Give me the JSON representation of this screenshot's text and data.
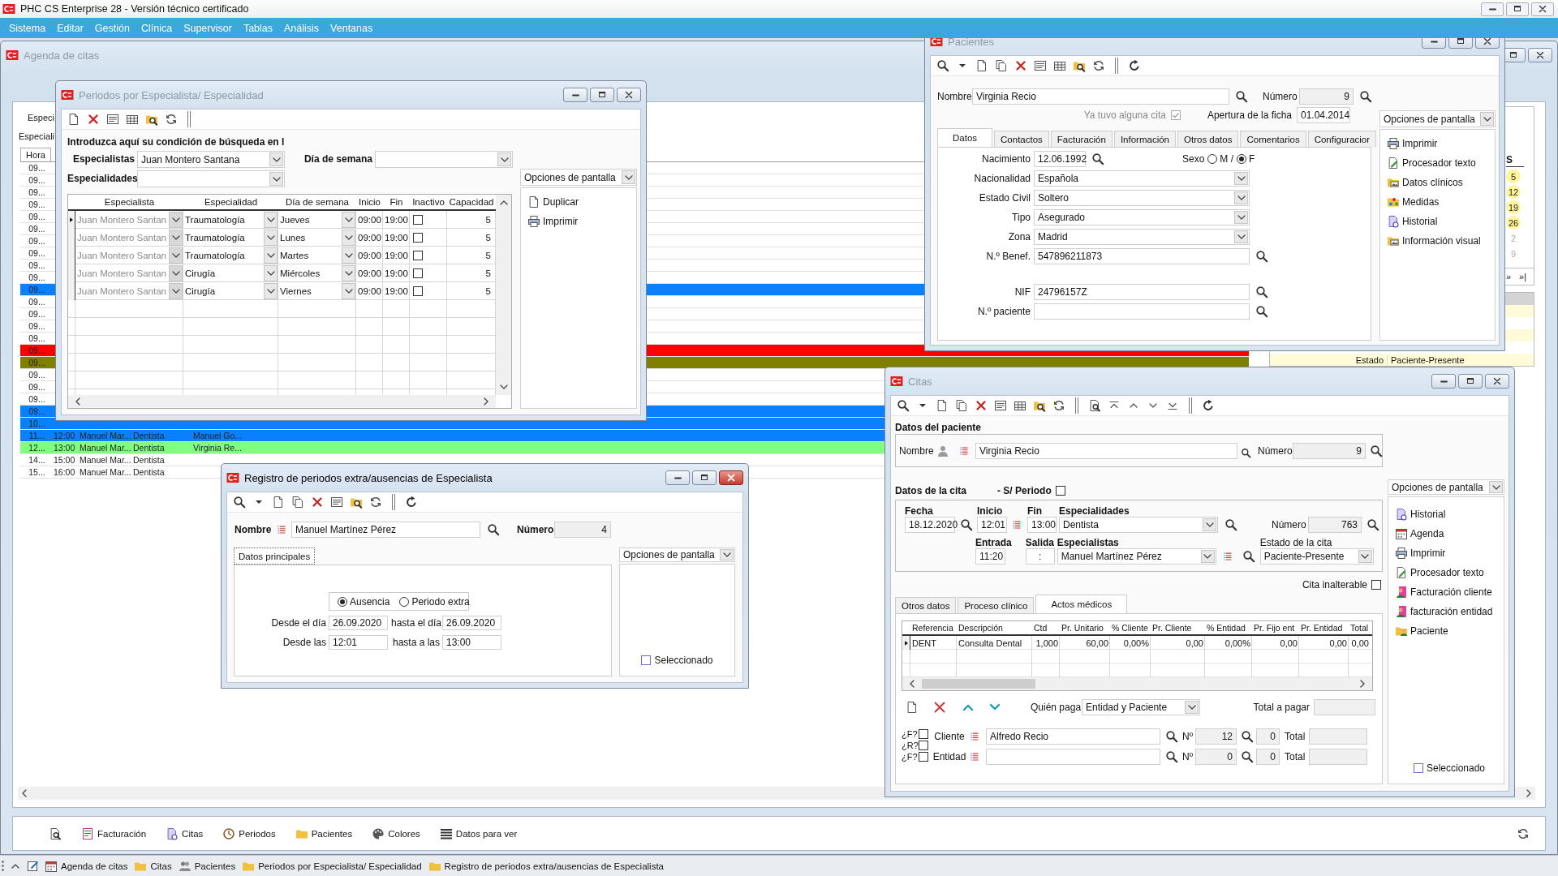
{
  "app": {
    "title": "PHC CS Enterprise 28 - Versión técnico certificado",
    "menu": [
      "Sistema",
      "Editar",
      "Gestión",
      "Clínica",
      "Supervisor",
      "Tablas",
      "Análisis",
      "Ventanas"
    ]
  },
  "agenda": {
    "title": "Agenda de citas",
    "active": false,
    "labels": [
      "Especi",
      "Especiali"
    ],
    "hora_header": "Hora",
    "rows": [
      {
        "cells": [
          "09..."
        ],
        "color": "#ffffff"
      },
      {
        "cells": [
          "09..."
        ],
        "color": "#ffffff"
      },
      {
        "cells": [
          "09..."
        ],
        "color": "#ffffff"
      },
      {
        "cells": [
          "09..."
        ],
        "color": "#ffffff"
      },
      {
        "cells": [
          "09..."
        ],
        "color": "#ffffff"
      },
      {
        "cells": [
          "09..."
        ],
        "color": "#ffffff"
      },
      {
        "cells": [
          "09..."
        ],
        "color": "#ffffff"
      },
      {
        "cells": [
          "09..."
        ],
        "color": "#ffffff"
      },
      {
        "cells": [
          "09..."
        ],
        "color": "#ffffff"
      },
      {
        "cells": [
          "09..."
        ],
        "color": "#ffffff"
      },
      {
        "cells": [
          "09..."
        ],
        "color": "#0a80ff"
      },
      {
        "cells": [
          "09..."
        ],
        "color": "#ffffff"
      },
      {
        "cells": [
          "09..."
        ],
        "color": "#ffffff"
      },
      {
        "cells": [
          "09..."
        ],
        "color": "#ffffff"
      },
      {
        "cells": [
          "09..."
        ],
        "color": "#ffffff"
      },
      {
        "cells": [
          "09..."
        ],
        "color": "#ff0000"
      },
      {
        "cells": [
          "09..."
        ],
        "color": "#808000"
      },
      {
        "cells": [
          "09..."
        ],
        "color": "#ffffff"
      },
      {
        "cells": [
          "09..."
        ],
        "color": "#ffffff"
      },
      {
        "cells": [
          "09..."
        ],
        "color": "#ffffff"
      },
      {
        "cells": [
          "09..."
        ],
        "color": "#0a80ff"
      },
      {
        "cells": [
          "10..."
        ],
        "color": "#0a80ff"
      },
      {
        "cells": [
          "11...",
          "12:00",
          "Manuel Mar...",
          "Dentista",
          "Manuel Go..."
        ],
        "color": "#0a80ff"
      },
      {
        "cells": [
          "12...",
          "13:00",
          "Manuel Mar...",
          "Dentista",
          "Virginia Re..."
        ],
        "color": "#80ff80"
      },
      {
        "cells": [
          "14...",
          "15:00",
          "Manuel Mar...",
          "Dentista"
        ],
        "color": "#ffffff"
      },
      {
        "cells": [
          "15...",
          "16:00",
          "Manuel Mar...",
          "Dentista"
        ],
        "color": "#ffffff"
      }
    ],
    "calendar": {
      "header": "S",
      "days": [
        {
          "label": "5",
          "marked": true
        },
        {
          "label": "12",
          "marked": true
        },
        {
          "label": "19",
          "marked": true
        },
        {
          "label": "26",
          "marked": true
        },
        {
          "label": "2",
          "marked": false
        },
        {
          "label": "9",
          "marked": false
        }
      ],
      "nav": [
        "»",
        "»|"
      ]
    },
    "details": [
      {
        "label": "Estado",
        "value": "Paciente-Presente"
      }
    ]
  },
  "periodos": {
    "title": "Periodos por Especialista/ Especialidad",
    "active": false,
    "prompt": "Introduzca aquí su condición de búsqueda en l",
    "filters": [
      {
        "label": "Especialistas",
        "value": "Juan Montero Santana"
      },
      {
        "label": "Día de semana"
      },
      {
        "label": "Especialidades"
      }
    ],
    "columns": [
      "Especialista",
      "Especialidad",
      "Día de semana",
      "Inicio",
      "Fin",
      "Inactivo",
      "Capacidad"
    ],
    "rows": [
      {
        "especialista": "Juan Montero Santan",
        "especialista_disabled": true,
        "especialidad": "Traumatología",
        "dia": "Jueves",
        "inicio": "09:00",
        "fin": "19:00",
        "inactivo": false,
        "capacidad": "5",
        "current": true
      },
      {
        "especialista": "Juan Montero Santan",
        "especialista_disabled": true,
        "especialidad": "Traumatología",
        "dia": "Lunes",
        "inicio": "09:00",
        "fin": "19:00",
        "inactivo": false,
        "capacidad": "5",
        "current": false
      },
      {
        "especialista": "Juan Montero Santan",
        "especialista_disabled": true,
        "especialidad": "Traumatología",
        "dia": "Martes",
        "inicio": "09:00",
        "fin": "19:00",
        "inactivo": false,
        "capacidad": "5",
        "current": false
      },
      {
        "especialista": "Juan Montero Santan",
        "especialista_disabled": true,
        "especialidad": "Cirugía",
        "dia": "Miércoles",
        "inicio": "09:00",
        "fin": "19:00",
        "inactivo": false,
        "capacidad": "5",
        "current": false
      },
      {
        "especialista": "Juan Montero Santan",
        "especialista_disabled": true,
        "especialidad": "Cirugía",
        "dia": "Viernes",
        "inicio": "09:00",
        "fin": "19:00",
        "inactivo": false,
        "capacidad": "5",
        "current": false
      }
    ],
    "options_label": "Opciones de pantalla",
    "actions": [
      "Duplicar",
      "Imprimir"
    ]
  },
  "pacientes": {
    "title": "Pacientes",
    "active": false,
    "nombre_label": "Nombre",
    "nombre": "Virginia Recio",
    "numero_label": "Número",
    "numero": "9",
    "ya_tuvo": {
      "label": "Ya tuvo alguna cita",
      "checked": true,
      "disabled": true
    },
    "apertura_label": "Apertura de la ficha",
    "apertura": "01.04.2014",
    "tabs": [
      {
        "label": "Datos",
        "selected": true
      },
      {
        "label": "Contactos",
        "selected": false
      },
      {
        "label": "Facturación",
        "selected": false
      },
      {
        "label": "Información",
        "selected": false
      },
      {
        "label": "Otros datos",
        "selected": false
      },
      {
        "label": "Comentarios",
        "selected": false
      },
      {
        "label": "Configuracior",
        "selected": false
      }
    ],
    "sexo": {
      "label": "Sexo",
      "options": [
        {
          "label": "M /",
          "selected": false
        },
        {
          "label": "F",
          "selected": true
        }
      ]
    },
    "fields": [
      {
        "kind": "date",
        "label": "Nacimiento",
        "value": "12.06.1992"
      },
      {
        "kind": "select",
        "label": "Nacionalidad",
        "value": "Española"
      },
      {
        "kind": "select",
        "label": "Estado Civil",
        "value": "Soltero"
      },
      {
        "kind": "select",
        "label": "Tipo",
        "value": "Asegurado"
      },
      {
        "kind": "select",
        "label": "Zona",
        "value": "Madrid"
      },
      {
        "kind": "search",
        "label": "N.º Benef.",
        "value": "547896211873"
      },
      {
        "kind": "search",
        "label": "NIF",
        "value": "24796157Z"
      },
      {
        "kind": "search",
        "label": "N.º paciente"
      }
    ],
    "options_label": "Opciones de pantalla",
    "actions": [
      "Imprimir",
      "Procesador texto",
      "Datos clínicos",
      "Medidas",
      "Historial",
      "Información visual"
    ]
  },
  "citas": {
    "title": "Citas",
    "active": false,
    "paciente": {
      "heading": "Datos del paciente",
      "nombre_label": "Nombre",
      "nombre": "Virginia Recio",
      "numero_label": "Número",
      "numero": "9"
    },
    "cita": {
      "heading": "Datos de la cita",
      "sin_periodo": {
        "label": "- S/ Periodo",
        "checked": false
      },
      "fecha": {
        "label": "Fecha",
        "value": "18.12.2020"
      },
      "inicio": {
        "label": "Inicio",
        "value": "12:01"
      },
      "fin": {
        "label": "Fin",
        "value": "13:00"
      },
      "especialidades": {
        "label": "Especialidades",
        "value": "Dentista"
      },
      "numero": {
        "label": "Número",
        "value": "763"
      },
      "entrada": {
        "label": "Entrada",
        "value": "11:20"
      },
      "salida": {
        "label": "Salida",
        "value": ":"
      },
      "especialistas": {
        "label": "Especialistas",
        "value": "Manuel Martínez Pérez"
      },
      "estado": {
        "label": "Estado de la cita",
        "value": "Paciente-Presente"
      },
      "inalterable": {
        "label": "Cita inalterable",
        "checked": false
      }
    },
    "tabs": [
      {
        "label": "Otros datos",
        "selected": false
      },
      {
        "label": "Proceso clínico",
        "selected": false
      },
      {
        "label": "Actos médicos",
        "selected": true
      }
    ],
    "table": {
      "columns": [
        "Referencia",
        "Descripción",
        "Ctd",
        "Pr. Unitario",
        "% Cliente",
        "Pr. Cliente",
        "% Entidad",
        "Pr. Fijo ent",
        "Pr. Entidad",
        "Total"
      ],
      "rows": [
        {
          "current": true,
          "cells": [
            "DENT",
            "Consulta Dental",
            "1,000",
            "60,00",
            "0,00%",
            "0,00",
            "0,00%",
            "0,00",
            "0,00",
            "0,00"
          ]
        }
      ]
    },
    "quien_paga": {
      "label": "Quién paga",
      "value": "Entidad y Paciente"
    },
    "total_pagar_label": "Total a pagar",
    "flags": [
      {
        "label": "¿F?",
        "checked": false
      },
      {
        "label": "¿R?",
        "checked": false
      },
      {
        "label": "¿F?",
        "checked": false
      }
    ],
    "payers": [
      {
        "label": "Cliente",
        "value": "Alfredo Recio",
        "n_label": "Nº",
        "n": "12",
        "count": "0",
        "total_label": "Total"
      },
      {
        "label": "Entidad",
        "n_label": "Nº",
        "n": "0",
        "count": "0",
        "total_label": "Total"
      }
    ],
    "options_label": "Opciones de pantalla",
    "actions": [
      "Historial",
      "Agenda",
      "Imprimir",
      "Procesador texto",
      "Facturación cliente",
      "facturación entidad",
      "Paciente"
    ],
    "seleccionado": {
      "label": "Seleccionado",
      "checked": false
    }
  },
  "registro": {
    "title": "Registro de periodos extra/ausencias de Especialista",
    "active": true,
    "nombre_label": "Nombre",
    "nombre": "Manuel Martínez Pérez",
    "numero_label": "Número",
    "numero": "4",
    "tabs": [
      {
        "label": "Datos principales",
        "selected": true
      }
    ],
    "tipo": [
      {
        "label": "Ausencia",
        "selected": true
      },
      {
        "label": "Periodo extra",
        "selected": false
      }
    ],
    "rows": [
      [
        {
          "label": "Desde el día",
          "value": "26.09.2020"
        },
        {
          "label": "hasta el día",
          "value": "26.09.2020"
        }
      ],
      [
        {
          "label": "Desde las",
          "value": "12:01"
        },
        {
          "label": "hasta a las",
          "value": "13:00"
        }
      ]
    ],
    "options_label": "Opciones de pantalla",
    "seleccionado": {
      "label": "Seleccionado",
      "checked": false
    }
  },
  "toolbar": [
    "Facturación",
    "Citas",
    "Periodos",
    "Pacientes",
    "Colores",
    "Datos para ver"
  ],
  "taskbar": [
    "Agenda de citas",
    "Citas",
    "Pacientes",
    "Periodos por Especialista/ Especialidad",
    "Registro de periodos extra/ausencias de Especialista"
  ]
}
